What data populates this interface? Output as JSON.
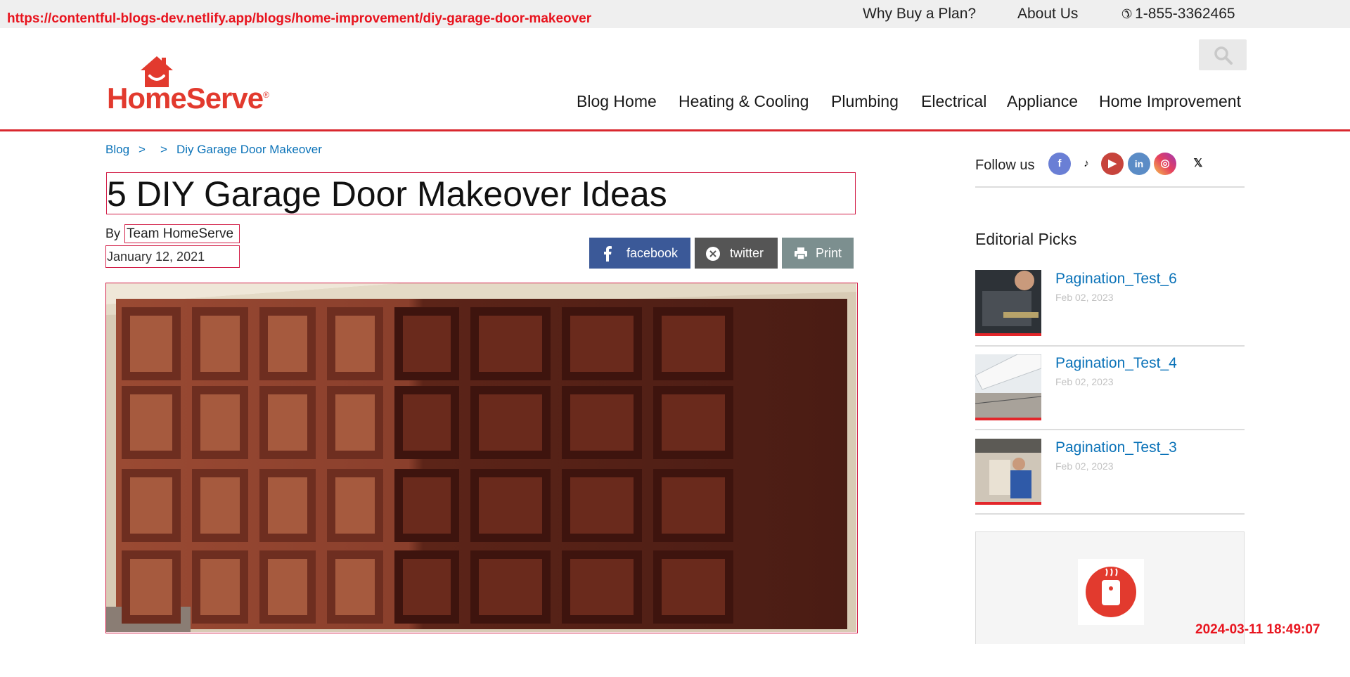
{
  "overlay": {
    "url": "https://contentful-blogs-dev.netlify.app/blogs/home-improvement/diy-garage-door-makeover",
    "timestamp": "2024-03-11 18:49:07"
  },
  "topbar": {
    "why_buy": "Why Buy a Plan?",
    "about": "About Us",
    "phone": "1-855-3362465"
  },
  "logo": {
    "text": "HomeServe"
  },
  "nav": {
    "items": [
      "Blog Home",
      "Heating & Cooling",
      "Plumbing",
      "Electrical",
      "Appliance",
      "Home Improvement"
    ]
  },
  "breadcrumb": {
    "blog": "Blog",
    "sep1": ">",
    "sep2": ">",
    "current": "Diy Garage Door Makeover"
  },
  "article": {
    "title": "5 DIY Garage Door Makeover Ideas",
    "by": "By",
    "author": "Team HomeServe",
    "date": "January 12, 2021"
  },
  "share": {
    "facebook": "facebook",
    "twitter": "twitter",
    "print": "Print"
  },
  "sidebar": {
    "follow_label": "Follow us",
    "social_icons": [
      "facebook-icon",
      "tiktok-icon",
      "youtube-icon",
      "linkedin-icon",
      "instagram-icon",
      "x-icon"
    ],
    "editorial_title": "Editorial Picks",
    "picks": [
      {
        "title": "Pagination_Test_6",
        "date": "Feb 02, 2023"
      },
      {
        "title": "Pagination_Test_4",
        "date": "Feb 02, 2023"
      },
      {
        "title": "Pagination_Test_3",
        "date": "Feb 02, 2023"
      }
    ]
  },
  "colors": {
    "brand_red": "#e23a2e",
    "link_blue": "#0a72b8",
    "facebook": "#3b5998",
    "twitter": "#555555",
    "print": "#7c8f8f"
  }
}
